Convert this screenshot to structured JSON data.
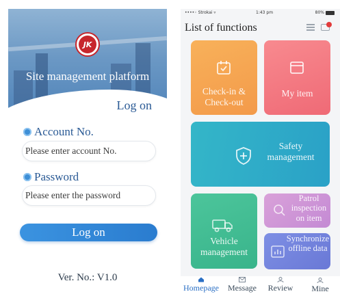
{
  "login": {
    "platform_title": "Site management platform",
    "logon_heading": "Log on",
    "account_label": "Account No.",
    "account_placeholder": "Please enter account No.",
    "password_label": "Password",
    "password_placeholder": "Please enter the password",
    "logon_button": "Log on",
    "version": "Ver. No.: V1.0",
    "logo_text": "JK"
  },
  "app": {
    "status_bar": {
      "carrier": "••••◦ Strokai ▿",
      "time": "1:43 pm",
      "battery": "80%"
    },
    "title": "List of functions",
    "tiles": {
      "checkin": "Check-in & Check-out",
      "myitem": "My item",
      "safety": "Safety management",
      "vehicle": "Vehicle management",
      "patrol": "Patrol inspection on item",
      "sync": "Synchronize offline data"
    },
    "tabs": {
      "home": "Homepage",
      "message": "Message",
      "review": "Review",
      "mine": "Mine"
    },
    "colors": {
      "checkin": "#f6a552",
      "myitem": "#f47a82",
      "safety": "#2faec8",
      "vehicle": "#43bd93",
      "patrol": "#cf97d6",
      "sync": "#7483dd",
      "accent": "#2a6fc4"
    }
  }
}
